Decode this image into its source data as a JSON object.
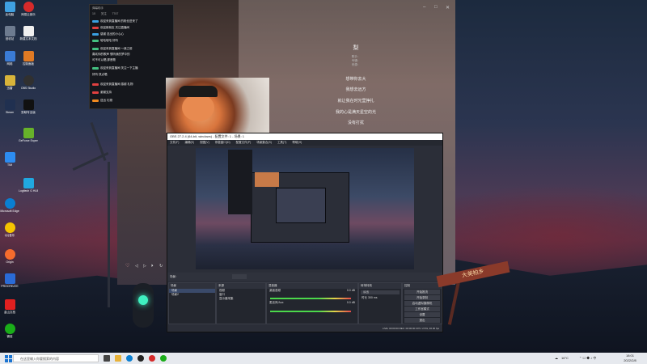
{
  "desktop": {
    "icons": [
      {
        "label": "此电脑",
        "color": "#3fa0e0"
      },
      {
        "label": "网易云音乐",
        "color": "#d62a2a"
      },
      {
        "label": "回收站",
        "color": "#6d7b8f"
      },
      {
        "label": "新建文本文档",
        "color": "#f0f0f0"
      },
      {
        "label": "网络",
        "color": "#3a7bd5"
      },
      {
        "label": "控制面板",
        "color": "#e07a24"
      },
      {
        "label": "迅雷",
        "color": "#d8b43a"
      },
      {
        "label": "OBS Studio",
        "color": "#303030"
      },
      {
        "label": "Steam",
        "color": "#203050"
      },
      {
        "label": "剪映专业版",
        "color": "#111111"
      },
      {
        "label": "GeForce Experience",
        "color": "#67b22a"
      },
      {
        "label": "TIM",
        "color": "#2d8cf0"
      },
      {
        "label": "Microsoft Edge",
        "color": "#0a7fd2"
      },
      {
        "label": "Logitech G HUB",
        "color": "#20a8e0"
      },
      {
        "label": "QQ音乐",
        "color": "#f5c400"
      },
      {
        "label": "Origin",
        "color": "#f56c2d"
      },
      {
        "label": "PROCREATE",
        "color": "#2a6bd6"
      },
      {
        "label": "金山文档",
        "color": "#e02020"
      },
      {
        "label": "微信",
        "color": "#1aad19"
      }
    ]
  },
  "music_player": {
    "window_controls": [
      "–",
      "□",
      "✕"
    ],
    "song_title": "梨",
    "meta_lines": [
      "歌手：",
      "专辑：",
      "来源："
    ],
    "lyrics": [
      "想带你去大",
      "我想去远方",
      "就让我在时光里挣扎",
      "我的心是满天星空的光",
      "没有打扰"
    ],
    "play_controls": [
      "♡",
      "◁",
      "▷",
      "⏵",
      "↻"
    ]
  },
  "chat_panel": {
    "header": "弹幕助手",
    "tabs": [
      "10",
      "关注",
      "7747"
    ],
    "messages": [
      "欢迎来到直播间 的粉丝进来了",
      "欢迎新朋友 关注直播间",
      "感谢 送出的小心心",
      "哈哈哈哈 好听",
      "欢迎来到直播间 ～我之前",
      "喜欢你的歌声 想听我的梦中的",
      "可不可以唱 那首歌",
      "欢迎来到直播间 关注一下主播",
      "好听 快点唱",
      "欢迎来到直播间 感谢 礼物",
      "谢谢支持",
      "送出 礼物"
    ]
  },
  "obs": {
    "title": "OBS 27.2.4 (64-bit, windows) - 配置文件: 1 - 场景: 1",
    "menu": [
      "文件(F)",
      "编辑(E)",
      "视图(V)",
      "停靠窗口(D)",
      "配置文件(P)",
      "场景集合(S)",
      "工具(T)",
      "帮助(H)"
    ],
    "scene_bar_label": "场景：",
    "docks": {
      "scenes": {
        "title": "场景",
        "items": [
          "场景",
          "场景2"
        ]
      },
      "sources": {
        "title": "来源",
        "items": [
          "视频",
          "窗口",
          "显示器采集"
        ]
      },
      "mixer": {
        "title": "混音器",
        "tracks": [
          "桌面音频",
          "麦克风/Aux"
        ],
        "db": [
          "0.0 dB",
          "0.0 dB"
        ]
      },
      "transitions": {
        "title": "转场特效",
        "value": "淡出",
        "duration_label": "时长",
        "duration": "300 ms"
      },
      "controls": {
        "title": "控制",
        "buttons": [
          "开始推流",
          "开始录制",
          "启动虚拟摄像机",
          "工作室模式",
          "设置",
          "退出"
        ]
      }
    },
    "status": "LIVE: 00:00:00   REC: 00:00:00   CPU: 2.5%, 30.00 fps"
  },
  "taskbar": {
    "search_placeholder": "在这里输入你要搜索的内容",
    "apps": [
      {
        "name": "task-view",
        "color": "#444"
      },
      {
        "name": "file-explorer",
        "color": "#e8b23a"
      },
      {
        "name": "edge",
        "color": "#0a7fd2"
      },
      {
        "name": "obs",
        "color": "#222"
      },
      {
        "name": "netease-music",
        "color": "#d62a2a"
      },
      {
        "name": "wechat",
        "color": "#1aad19"
      }
    ],
    "weather": "16°C",
    "time": "18:01",
    "date": "2022/2/8"
  },
  "wallpaper_sign": "大美柏乡"
}
